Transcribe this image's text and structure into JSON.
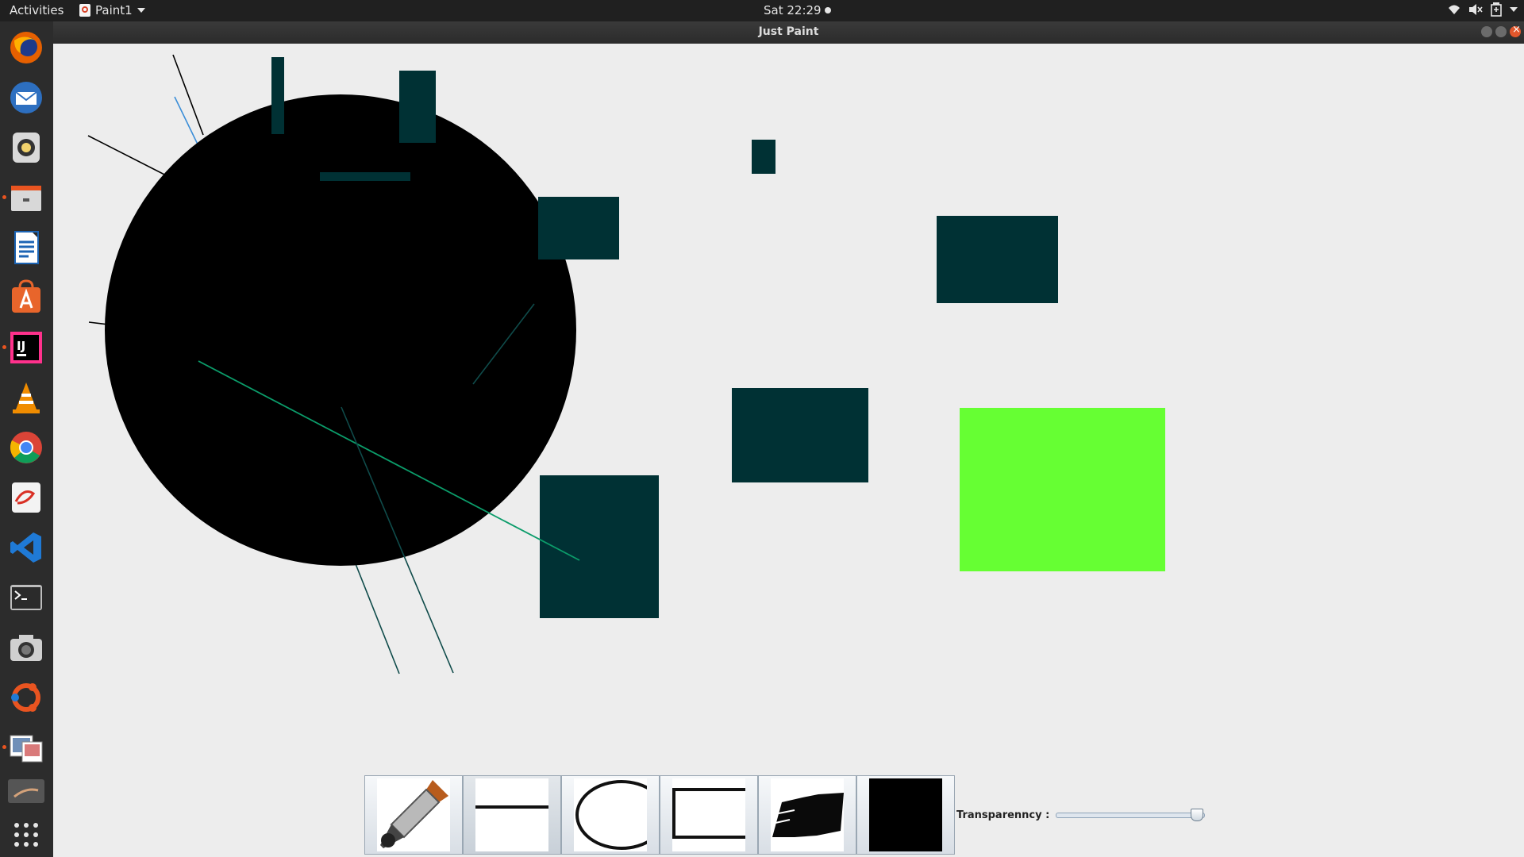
{
  "topbar": {
    "activities": "Activities",
    "app_menu": "Paint1",
    "clock": "Sat 22:29"
  },
  "window": {
    "title": "Just Paint"
  },
  "dock": {
    "items": [
      {
        "name": "firefox-icon",
        "color": "#e66000"
      },
      {
        "name": "thunderbird-icon",
        "color": "#2d6fc0"
      },
      {
        "name": "rhythmbox-icon",
        "color": "#f1d26c"
      },
      {
        "name": "files-icon",
        "color": "#c9c9c9"
      },
      {
        "name": "writer-icon",
        "color": "#1c64b4"
      },
      {
        "name": "software-center-icon",
        "color": "#e8652b"
      },
      {
        "name": "intellij-icon",
        "color": "#000000"
      },
      {
        "name": "vlc-icon",
        "color": "#f08c00"
      },
      {
        "name": "chrome-icon",
        "color": "#4285f4"
      },
      {
        "name": "evince-icon",
        "color": "#d93025"
      },
      {
        "name": "vscode-icon",
        "color": "#1f7ad6"
      },
      {
        "name": "terminal-icon",
        "color": "#2b2b2b"
      },
      {
        "name": "camera-icon",
        "color": "#bfbfbf"
      },
      {
        "name": "ubuntu-help-icon",
        "color": "#e95420"
      },
      {
        "name": "image-viewer-icon",
        "color": "#6f8fb8"
      },
      {
        "name": "app-running-icon",
        "color": "#9a9a9a"
      },
      {
        "name": "show-apps-icon",
        "color": "#e6e6e6"
      }
    ]
  },
  "colors": {
    "shape_dark": "#003134",
    "circle": "#000000",
    "green_rect": "#66ff33",
    "line_green": "#0b9c6a",
    "line_teal": "#0f4b4a",
    "line_blue": "#3b8ed8"
  },
  "toolbar": {
    "tools": [
      {
        "name": "pen-tool-button",
        "icon": "fountain-pen-icon"
      },
      {
        "name": "line-tool-button",
        "icon": "line-icon"
      },
      {
        "name": "ellipse-tool-button",
        "icon": "ellipse-icon"
      },
      {
        "name": "rectangle-tool-button",
        "icon": "rectangle-icon"
      },
      {
        "name": "brush-tool-button",
        "icon": "brush-stroke-icon"
      },
      {
        "name": "fill-tool-button",
        "icon": "filled-square-icon"
      }
    ],
    "selected_index": 1,
    "transparency_label": "Transparenncy :",
    "transparency_value": 1.0
  }
}
